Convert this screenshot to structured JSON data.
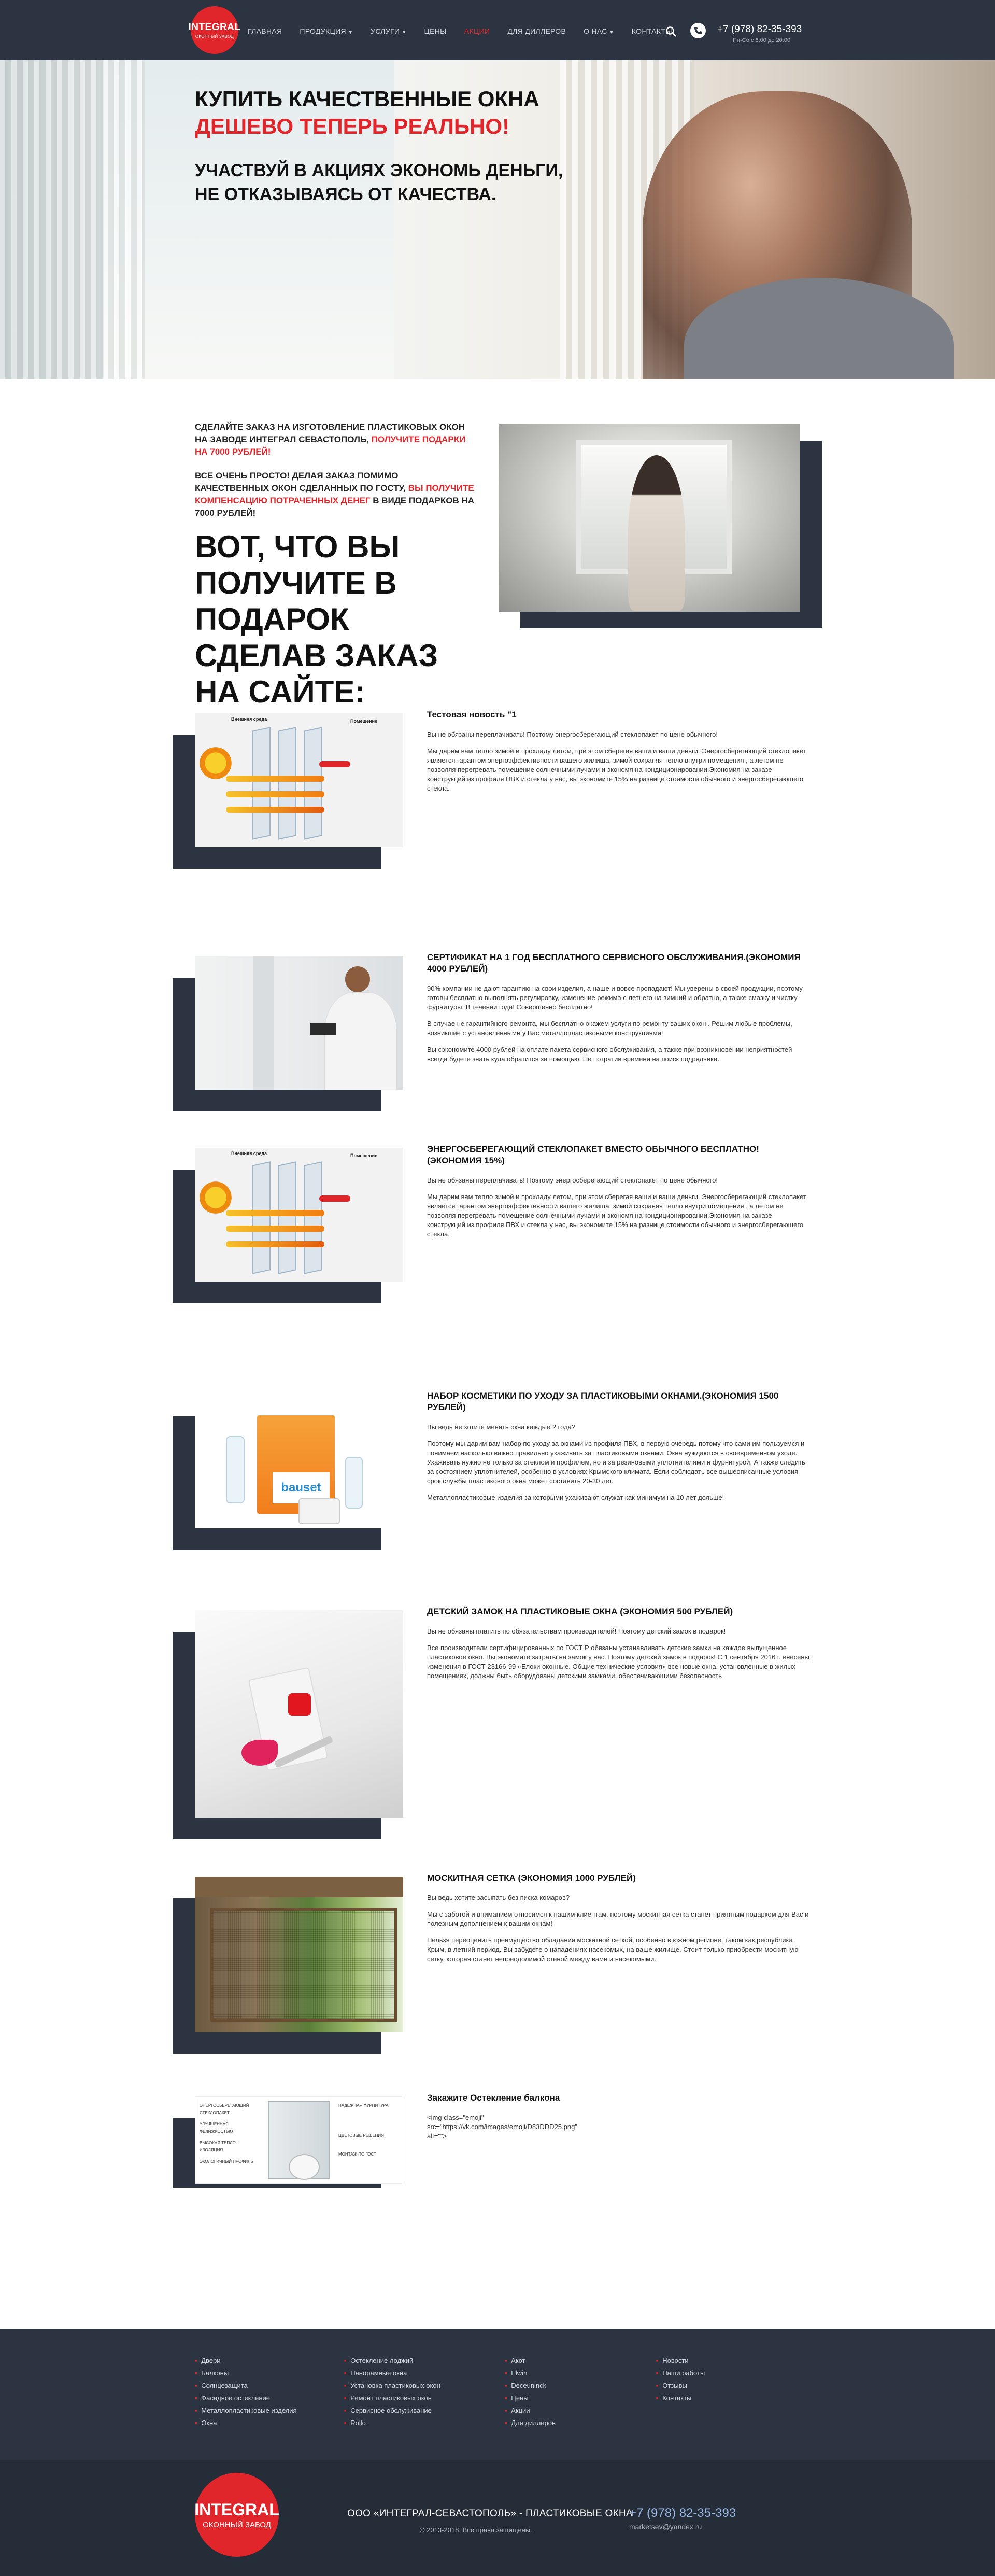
{
  "header": {
    "logo": {
      "line1": "INTEGRAL",
      "line2": "ОКОННЫЙ ЗАВОД"
    },
    "nav": [
      {
        "label": "Главная"
      },
      {
        "label": "Продукция"
      },
      {
        "label": "Услуги"
      },
      {
        "label": "Цены"
      },
      {
        "label": "Акции"
      },
      {
        "label": "Для диллеров"
      },
      {
        "label": "О нас"
      },
      {
        "label": "Контакты"
      }
    ],
    "phone": "+7 (978) 82-35-393",
    "hours": "Пн-Сб с 8:00 до 20:00"
  },
  "hero": {
    "title_line1": "Купить качественные окна",
    "title_line2": "дешево теперь реально!",
    "subtitle_line1": "Участвуй в акциях экономь деньги,",
    "subtitle_line2": "не отказываясь от качества."
  },
  "promo": {
    "p1_part1": "Сделайте заказ на изготовление пластиковых окон на заводе Интеграл Севастополь, ",
    "p1_red": "получите подарки на 7000 рублей!",
    "p2_part1": "Все очень просто! Делая заказ помимо качественных окон сделанных по ГОСТу, ",
    "p2_red": "вы получите компенсацию потраченных денег",
    "p2_part2": " в виде подарков на 7000 рублей!",
    "heading": "Вот, что вы получите в подарок сделав заказ на сайте:"
  },
  "features": [
    {
      "title": "Тестовая новость \"1",
      "paragraphs": [
        "Вы не обязаны переплачивать! Поэтому энергосберегающий стеклопакет по цене обычного!",
        "Мы дарим вам тепло зимой и прохладу летом, при этом сберегая ваши и ваши деньги. Энергосберегающий стеклопакет является гарантом энергоэффективности вашего жилища, зимой сохраняя тепло внутри помещения , а летом не позволяя перегревать помещение солнечными лучами и экономя на кондиционировании.Экономия на заказе конструкций из профиля ПВХ и стекла у нас, вы экономите 15% на разнице стоимости обычного и энергосберегающего стекла."
      ]
    },
    {
      "title": "Сертификат на 1 год бесплатного сервисного обслуживания.(экономия 4000 рублей)",
      "paragraphs": [
        "90% компании не дают гарантию на свои изделия, а наше и вовсе пропадают! Мы уверены в своей продукции, поэтому готовы бесплатно выполнять регулировку, изменение режима с летнего на зимний и обратно, а также смазку и чистку фурнитуры. В течении года! Совершенно бесплатно!",
        "В случае не гарантийного ремонта, мы бесплатно окажем услуги по ремонту ваших окон . Решим любые проблемы, возникшие с установленными у Вас металлопластиковыми конструкциями!",
        "Вы сэкономите 4000 рублей на оплате пакета сервисного обслуживания, а также при возникновении неприятностей всегда будете знать куда обратится за помощью. Не потратив времени на поиск подрядчика."
      ]
    },
    {
      "title": "Энергосберегающий стеклопакет вместо обычного бесплатно! (экономия 15%)",
      "paragraphs": [
        "Вы не обязаны переплачивать! Поэтому энергосберегающий стеклопакет по цене обычного!",
        "Мы дарим вам тепло зимой и прохладу летом, при этом сберегая ваши и ваши деньги. Энергосберегающий стеклопакет является гарантом энергоэффективности вашего жилища, зимой сохраняя тепло внутри помещения , а летом не позволяя перегревать помещение солнечными лучами и экономя на кондиционировании.Экономия на заказе конструкций из профиля ПВХ и стекла у нас, вы экономите 15% на разнице стоимости обычного и энергосберегающего стекла."
      ]
    },
    {
      "title": "Набор косметики по уходу за пластиковыми окнами.(экономия 1500 рублей)",
      "paragraphs": [
        "Вы ведь не хотите менять окна каждые 2 года?",
        "Поэтому мы дарим вам набор по уходу за окнами из профиля ПВХ, в первую очередь потому что сами им пользуемся и понимаем насколько важно правильно ухаживать за пластиковыми окнами. Окна нуждаются в своевременном уходе. Ухаживать нужно не только за стеклом и профилем, но и за резиновыми уплотнителями и фурнитурой. А также следить за состоянием уплотнителей, особенно в условиях Крымского климата. Если соблюдать все вышеописанные условия срок службы пластикового окна может составить 20-30 лет.",
        "Металлопластиковые изделия за которыми ухаживают служат как минимум на 10 лет дольше!"
      ]
    },
    {
      "title": "Детский замок на пластиковые окна (экономия 500 рублей)",
      "paragraphs": [
        "Вы не обязаны платить по обязательствам производителей! Поэтому детский замок в подарок!",
        "Все производители сертифицированных по ГОСТ Р обязаны устанавливать детские замки на каждое выпущенное пластиковое окно. Вы экономите затраты на замок у нас. Поэтому детский замок в подарок! С 1 сентября 2016 г. внесены изменения в ГОСТ 23166-99 «Блоки оконные. Общие технические условия» все новые окна, установленные в жилых помещениях, должны быть оборудованы детскими замками, обеспечивающими безопасность"
      ]
    },
    {
      "title": "Москитная сетка (экономия 1000 рублей)",
      "paragraphs": [
        "Вы ведь хотите засыпать без писка комаров?",
        "Мы с заботой и вниманием относимся к нашим клиентам, поэтому москитная сетка станет приятным подарком для Вас и полезным дополнением к вашим окнам!",
        "Нельзя переоценить преимущество обладания москитной сеткой, особенно в южном регионе, таком как республика Крым, в летний период. Вы забудете о нападениях насекомых, на ваше жилище. Стоит только приобрести москитную сетку, которая станет непреодолимой стеной между вами и насекомыми."
      ]
    },
    {
      "title": "Закажите Остекление балкона",
      "paragraphs": [
        "<img class=\"emoji\" src=\"https://vk.com/images/emoji/D83DDD25.png\" alt=\"\">"
      ]
    }
  ],
  "illustration": {
    "outside": "Внешняя среда",
    "inside": "Помещение",
    "profile_labels": [
      "ЭНЕРГОСБЕРЕГАЮЩИЙ СТЕКЛОПАКЕТ",
      "УЛУЧШЕННАЯ ФЕЛИЖКОСТЬЮ",
      "ВЫСОКАЯ ТЕПЛО-ИЗОЛЯЦИЯ",
      "ЭКОЛОГИЧНЫЙ ПРОФИЛЬ",
      "НАДЕЖНАЯ ФУРНИТУРА",
      "ЦВЕТОВЫЕ РЕШЕНИЯ",
      "МОНТАЖ ПО ГОСТ"
    ],
    "brand": "bauset"
  },
  "footer": {
    "columns": [
      [
        "Двери",
        "Балконы",
        "Солнцезащита",
        "Фасадное остекление",
        "Металлопластиковые изделия",
        "Окна"
      ],
      [
        "Остекление лоджий",
        "Панорамные окна",
        "Установка пластиковых окон",
        "Ремонт пластиковых окон",
        "Сервисное обслуживание",
        "Rollo"
      ],
      [
        "Акот",
        "Elwin",
        "Deceuninck",
        "Цены",
        "Акции",
        "Для диллеров"
      ],
      [
        "Новости",
        "Наши работы",
        "Отзывы",
        "Контакты"
      ]
    ],
    "logo": {
      "line1": "INTEGRAL",
      "line2": "ОКОННЫЙ ЗАВОД"
    },
    "company": "ООО «ИНТЕГРАЛ-СЕВАСТОПОЛЬ» - ПЛАСТИКОВЫЕ ОКНА",
    "copyright": "© 2013-2018. Все права защищены.",
    "phone": "+7 (978) 82-35-393",
    "email": "marketsev@yandex.ru"
  },
  "colors": {
    "dark": "#2b3440",
    "darker": "#252d38",
    "accent": "#e0262a"
  }
}
